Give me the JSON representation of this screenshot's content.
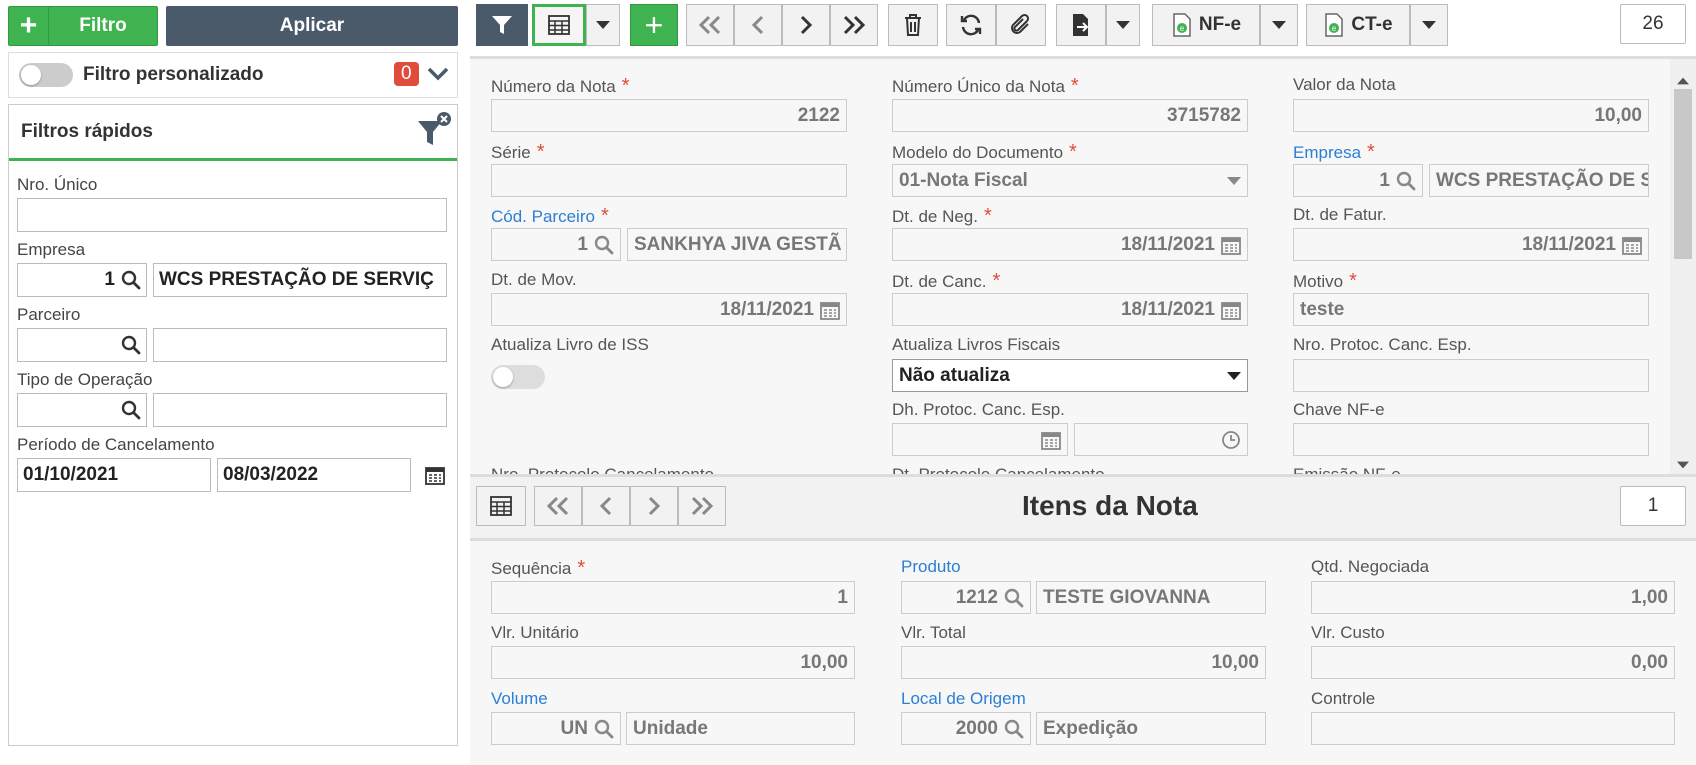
{
  "left": {
    "filtro_label": "Filtro",
    "aplicar_label": "Aplicar",
    "custom_filter_label": "Filtro personalizado",
    "custom_filter_count": "0",
    "quick_filters_title": "Filtros rápidos",
    "fields": {
      "nro_unico_label": "Nro. Único",
      "empresa_label": "Empresa",
      "empresa_code": "1",
      "empresa_name": "WCS PRESTAÇÃO DE SERVIÇ",
      "parceiro_label": "Parceiro",
      "tipo_operacao_label": "Tipo de Operação",
      "periodo_label": "Período de Cancelamento",
      "periodo_start": "01/10/2021",
      "periodo_end": "08/03/2022"
    }
  },
  "toolbar": {
    "nfe_label": "NF-e",
    "cte_label": "CT-e",
    "record_count": "26",
    "accent": "#3fb34f",
    "dark": "#4a5a6a"
  },
  "form": {
    "numero_nota": {
      "label": "Número da Nota",
      "value": "2122"
    },
    "numero_unico": {
      "label": "Número Único da Nota",
      "value": "3715782"
    },
    "valor_nota": {
      "label": "Valor da Nota",
      "value": "10,00"
    },
    "serie": {
      "label": "Série",
      "value": ""
    },
    "modelo_doc": {
      "label": "Modelo do Documento",
      "value": "01-Nota Fiscal"
    },
    "empresa": {
      "label": "Empresa",
      "code": "1",
      "name": "WCS PRESTAÇÃO DE S"
    },
    "cod_parceiro": {
      "label": "Cód. Parceiro",
      "code": "1",
      "name": "SANKHYA JIVA GESTÃ"
    },
    "dt_neg": {
      "label": "Dt. de Neg.",
      "value": "18/11/2021"
    },
    "dt_fatur": {
      "label": "Dt. de Fatur.",
      "value": "18/11/2021"
    },
    "dt_mov": {
      "label": "Dt. de Mov.",
      "value": "18/11/2021"
    },
    "dt_canc": {
      "label": "Dt. de Canc.",
      "value": "18/11/2021"
    },
    "motivo": {
      "label": "Motivo",
      "value": "teste"
    },
    "atualiza_iss": {
      "label": "Atualiza Livro de ISS"
    },
    "atualiza_fiscais": {
      "label": "Atualiza Livros Fiscais",
      "value": "Não atualiza"
    },
    "nro_protoc": {
      "label": "Nro. Protoc. Canc. Esp."
    },
    "dh_protoc": {
      "label": "Dh. Protoc. Canc. Esp."
    },
    "chave_nfe": {
      "label": "Chave NF-e"
    },
    "nro_protocolo_canc": {
      "label": "Nro. Protocolo Cancelamento"
    },
    "dt_protocolo_canc": {
      "label": "Dt. Protocolo Cancelamento"
    },
    "emissao_nfe": {
      "label": "Emissão NF-e"
    }
  },
  "items": {
    "title": "Itens da Nota",
    "record_count": "1",
    "sequencia": {
      "label": "Sequência",
      "value": "1"
    },
    "produto": {
      "label": "Produto",
      "code": "1212",
      "name": "TESTE GIOVANNA"
    },
    "qtd_negociada": {
      "label": "Qtd. Negociada",
      "value": "1,00"
    },
    "vlr_unitario": {
      "label": "Vlr. Unitário",
      "value": "10,00"
    },
    "vlr_total": {
      "label": "Vlr. Total",
      "value": "10,00"
    },
    "vlr_custo": {
      "label": "Vlr. Custo",
      "value": "0,00"
    },
    "volume": {
      "label": "Volume",
      "code": "UN",
      "name": "Unidade"
    },
    "local_origem": {
      "label": "Local de Origem",
      "code": "2000",
      "name": "Expedição"
    },
    "controle": {
      "label": "Controle",
      "value": ""
    }
  }
}
